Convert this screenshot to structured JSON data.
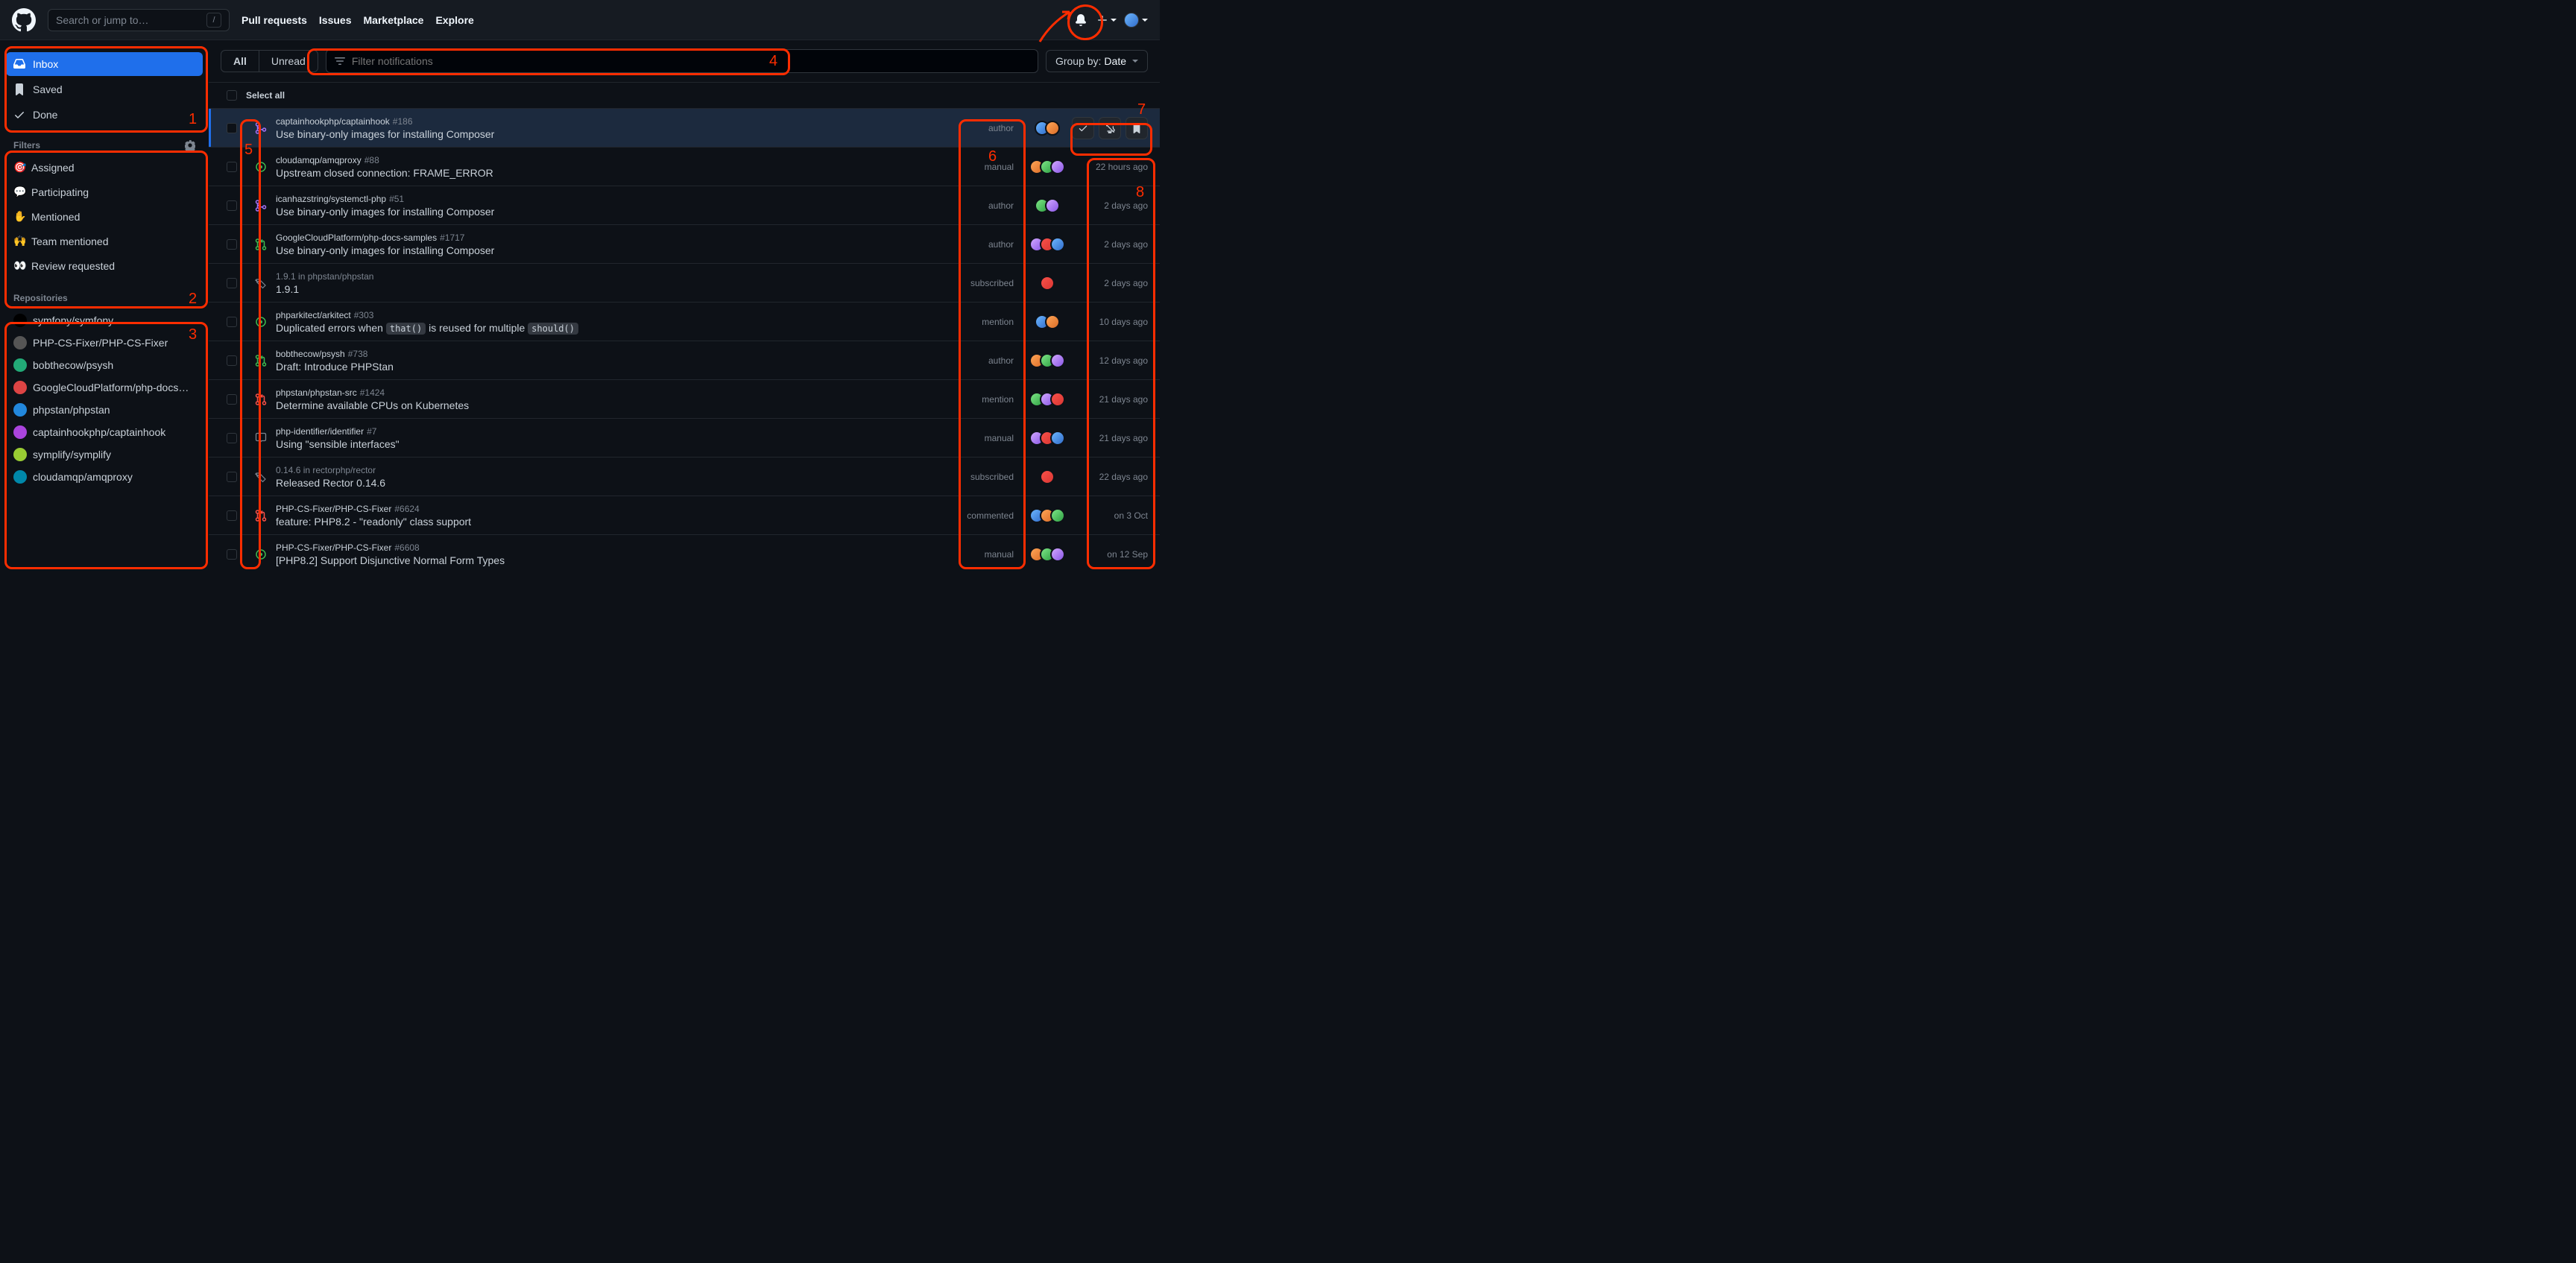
{
  "header": {
    "search_placeholder": "Search or jump to…",
    "slash": "/",
    "nav": [
      "Pull requests",
      "Issues",
      "Marketplace",
      "Explore"
    ]
  },
  "sidebar": {
    "views": [
      {
        "label": "Inbox",
        "icon": "inbox",
        "active": true
      },
      {
        "label": "Saved",
        "icon": "bookmark",
        "active": false
      },
      {
        "label": "Done",
        "icon": "check",
        "active": false
      }
    ],
    "filters_header": "Filters",
    "filters": [
      {
        "emoji": "🎯",
        "label": "Assigned"
      },
      {
        "emoji": "💬",
        "label": "Participating"
      },
      {
        "emoji": "✋",
        "label": "Mentioned"
      },
      {
        "emoji": "🙌",
        "label": "Team mentioned"
      },
      {
        "emoji": "👀",
        "label": "Review requested"
      }
    ],
    "repos_header": "Repositories",
    "repos": [
      "symfony/symfony",
      "PHP-CS-Fixer/PHP-CS-Fixer",
      "bobthecow/psysh",
      "GoogleCloudPlatform/php-docs…",
      "phpstan/phpstan",
      "captainhookphp/captainhook",
      "symplify/symplify",
      "cloudamqp/amqproxy"
    ]
  },
  "toolbar": {
    "tabs": {
      "all": "All",
      "unread": "Unread"
    },
    "filter_placeholder": "Filter notifications",
    "group_label": "Group by:",
    "group_value": "Date"
  },
  "select_all": "Select all",
  "notifications": [
    {
      "repo": "captainhookphp/captainhook",
      "ref": "#186",
      "title": "Use binary-only images for installing Composer",
      "reason": "author",
      "time": "",
      "icon": "pr-merged",
      "active": true,
      "avatars": 2,
      "show_actions": true
    },
    {
      "repo": "cloudamqp/amqproxy",
      "ref": "#88",
      "title": "Upstream closed connection: FRAME_ERROR",
      "reason": "manual",
      "time": "22 hours ago",
      "icon": "issue-open",
      "avatars": 3
    },
    {
      "repo": "icanhazstring/systemctl-php",
      "ref": "#51",
      "title": "Use binary-only images for installing Composer",
      "reason": "author",
      "time": "2 days ago",
      "icon": "pr-merged",
      "avatars": 2
    },
    {
      "repo": "GoogleCloudPlatform/php-docs-samples",
      "ref": "#1717",
      "title": "Use binary-only images for installing Composer",
      "reason": "author",
      "time": "2 days ago",
      "icon": "pr-open",
      "avatars": 3
    },
    {
      "repo": "",
      "ref": "1.9.1 in phpstan/phpstan",
      "title": "1.9.1",
      "reason": "subscribed",
      "time": "2 days ago",
      "icon": "tag",
      "avatars": 1
    },
    {
      "repo": "phparkitect/arkitect",
      "ref": "#303",
      "title_html": "Duplicated errors when <span class='code-frag'>that()</span> is reused for multiple <span class='code-frag'>should()</span>",
      "title": "Duplicated errors when that() is reused for multiple should()",
      "reason": "mention",
      "time": "10 days ago",
      "icon": "issue-open",
      "avatars": 2
    },
    {
      "repo": "bobthecow/psysh",
      "ref": "#738",
      "title": "Draft: Introduce PHPStan",
      "reason": "author",
      "time": "12 days ago",
      "icon": "pr-open",
      "avatars": 3
    },
    {
      "repo": "phpstan/phpstan-src",
      "ref": "#1424",
      "title": "Determine available CPUs on Kubernetes",
      "reason": "mention",
      "time": "21 days ago",
      "icon": "pr-closed",
      "avatars": 3
    },
    {
      "repo": "php-identifier/identifier",
      "ref": "#7",
      "title": "Using \"sensible interfaces\"",
      "reason": "manual",
      "time": "21 days ago",
      "icon": "discussion",
      "avatars": 3
    },
    {
      "repo": "",
      "ref": "0.14.6 in rectorphp/rector",
      "title": "Released Rector 0.14.6",
      "reason": "subscribed",
      "time": "22 days ago",
      "icon": "tag",
      "avatars": 1
    },
    {
      "repo": "PHP-CS-Fixer/PHP-CS-Fixer",
      "ref": "#6624",
      "title": "feature: PHP8.2 - \"readonly\" class support",
      "reason": "commented",
      "time": "on 3 Oct",
      "icon": "pr-closed",
      "avatars": 3
    },
    {
      "repo": "PHP-CS-Fixer/PHP-CS-Fixer",
      "ref": "#6608",
      "title": "[PHP8.2] Support Disjunctive Normal Form Types",
      "reason": "manual",
      "time": "on 12 Sep",
      "icon": "issue-open",
      "avatars": 3
    }
  ],
  "annotations": {
    "1": "1",
    "2": "2",
    "3": "3",
    "4": "4",
    "5": "5",
    "6": "6",
    "7": "7",
    "8": "8"
  }
}
